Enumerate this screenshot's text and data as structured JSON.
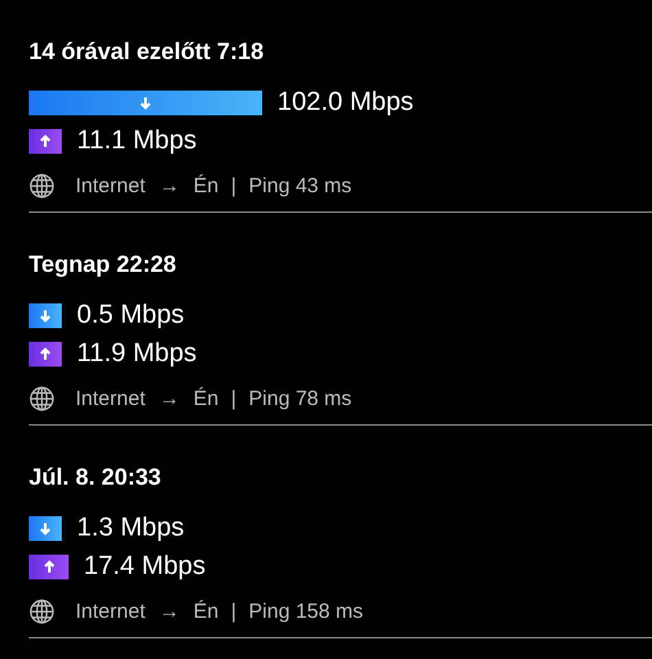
{
  "tests": [
    {
      "time": "14 órával ezelőtt 7:18",
      "download": {
        "reading": "102.0 Mbps"
      },
      "upload": {
        "reading": "11.1 Mbps"
      },
      "route": {
        "from": "Internet",
        "arrow": "→",
        "to": "Én",
        "separator": "|",
        "ping": "Ping 43 ms"
      }
    },
    {
      "time": "Tegnap 22:28",
      "download": {
        "reading": "0.5 Mbps"
      },
      "upload": {
        "reading": "11.9 Mbps"
      },
      "route": {
        "from": "Internet",
        "arrow": "→",
        "to": "Én",
        "separator": "|",
        "ping": "Ping 78 ms"
      }
    },
    {
      "time": "Júl. 8. 20:33",
      "download": {
        "reading": "1.3 Mbps"
      },
      "upload": {
        "reading": "17.4 Mbps"
      },
      "route": {
        "from": "Internet",
        "arrow": "→",
        "to": "Én",
        "separator": "|",
        "ping": "Ping 158 ms"
      }
    }
  ]
}
